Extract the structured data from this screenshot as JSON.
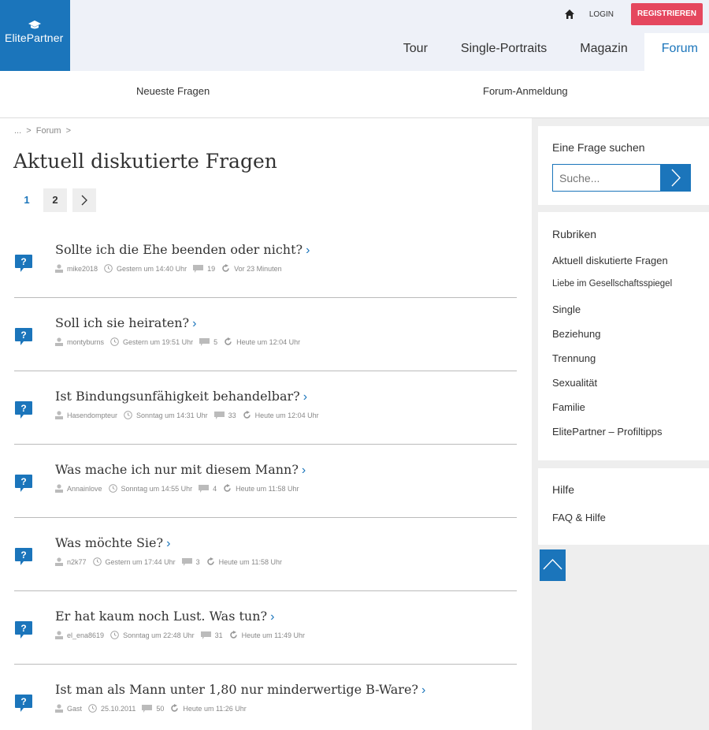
{
  "header": {
    "brand": "ElitePartner",
    "login": "LOGIN",
    "register": "REGISTRIEREN",
    "nav": [
      {
        "label": "Tour"
      },
      {
        "label": "Single-Portraits"
      },
      {
        "label": "Magazin"
      },
      {
        "label": "Forum",
        "active": true
      }
    ]
  },
  "subnav": {
    "newest": "Neueste Fragen",
    "signup": "Forum-Anmeldung"
  },
  "breadcrumb": {
    "ellipsis": "...",
    "sep": ">",
    "forum": "Forum"
  },
  "page": {
    "title": "Aktuell diskutierte Fragen"
  },
  "pagination": {
    "pages": [
      "1",
      "2"
    ],
    "current": "1",
    "next": ">"
  },
  "questions": [
    {
      "title": "Sollte ich die Ehe beenden oder nicht?",
      "author": "mike2018",
      "created": "Gestern um 14:40 Uhr",
      "replies": "19",
      "updated": "Vor 23 Minuten"
    },
    {
      "title": "Soll ich sie heiraten?",
      "author": "montyburns",
      "created": "Gestern um 19:51 Uhr",
      "replies": "5",
      "updated": "Heute um 12:04 Uhr"
    },
    {
      "title": "Ist Bindungsunfähigkeit behandelbar?",
      "author": "Hasendompteur",
      "created": "Sonntag um 14:31 Uhr",
      "replies": "33",
      "updated": "Heute um 12:04 Uhr"
    },
    {
      "title": "Was mache ich nur mit diesem Mann?",
      "author": "Annainlove",
      "created": "Sonntag um 14:55 Uhr",
      "replies": "4",
      "updated": "Heute um 11:58 Uhr"
    },
    {
      "title": "Was möchte Sie?",
      "author": "n2k77",
      "created": "Gestern um 17:44 Uhr",
      "replies": "3",
      "updated": "Heute um 11:58 Uhr"
    },
    {
      "title": "Er hat kaum noch Lust. Was tun?",
      "author": "el_ena8619",
      "created": "Sonntag um 22:48 Uhr",
      "replies": "31",
      "updated": "Heute um 11:49 Uhr"
    },
    {
      "title": "Ist man als Mann unter 1,80 nur minderwertige B-Ware?",
      "author": "Gast",
      "created": "25.10.2011",
      "replies": "50",
      "updated": "Heute um 11:26 Uhr"
    }
  ],
  "sidebar": {
    "search_title": "Eine Frage suchen",
    "search_placeholder": "Suche...",
    "rubriken_title": "Rubriken",
    "rubriken": [
      "Aktuell diskutierte Fragen",
      "Liebe im Gesellschaftsspiegel",
      "Single",
      "Beziehung",
      "Trennung",
      "Sexualität",
      "Familie",
      "ElitePartner – Profiltipps"
    ],
    "help_title": "Hilfe",
    "faq": "FAQ & Hilfe"
  },
  "colors": {
    "brand_blue": "#1b75bb",
    "register_red": "#e5475e",
    "header_bg": "#eef1f8",
    "sidebar_bg": "#eeeeee"
  },
  "icons": [
    "graduation-cap-icon",
    "home-icon",
    "question-bubble-icon",
    "user-icon",
    "clock-icon",
    "comment-icon",
    "refresh-icon",
    "chevron-right-icon",
    "chevron-up-icon"
  ]
}
